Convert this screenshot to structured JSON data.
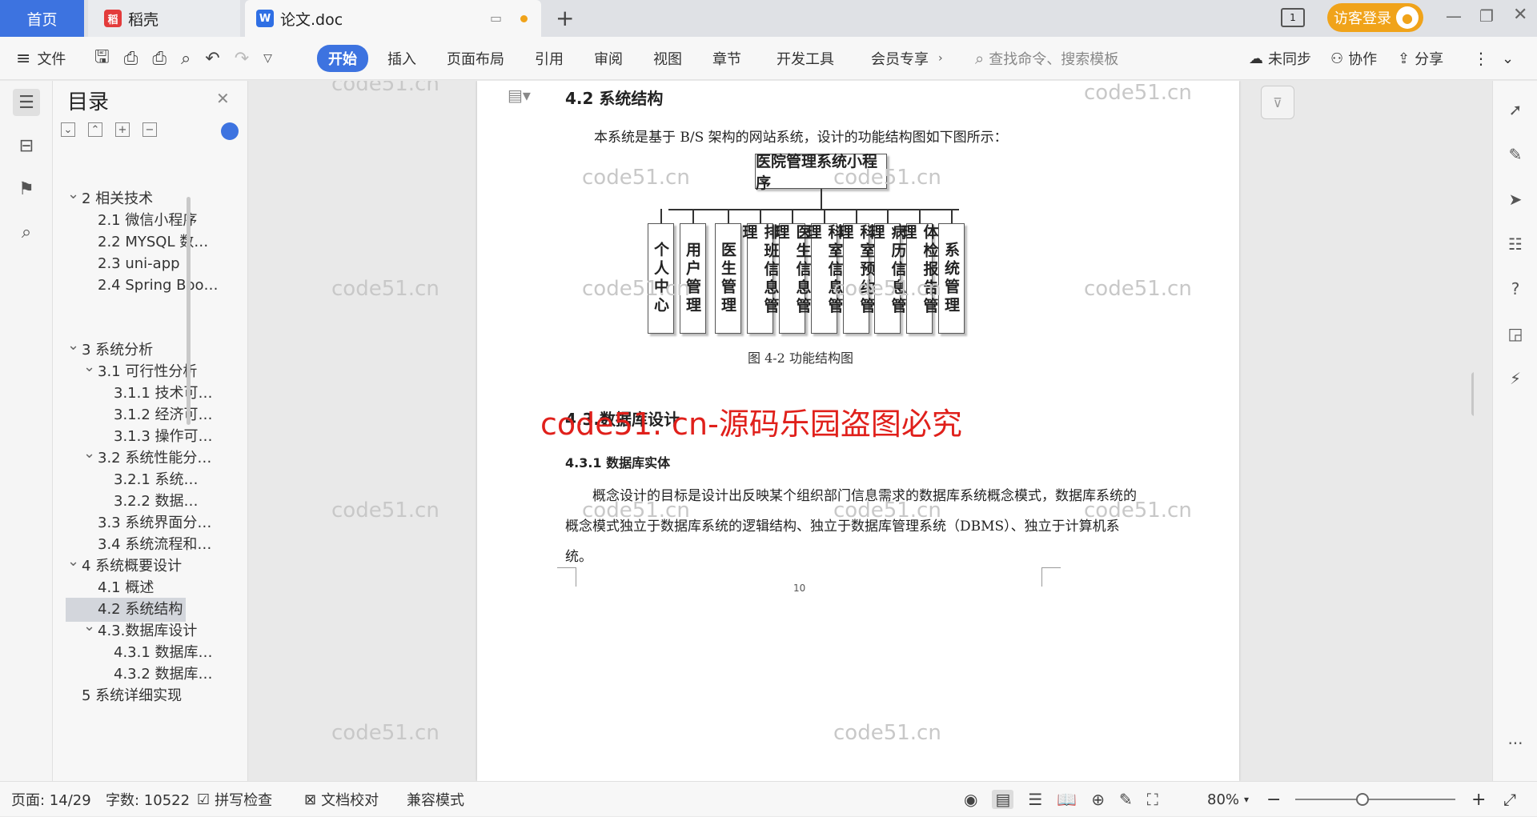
{
  "tabs": {
    "home": "首页",
    "daoke": "稻壳",
    "doc": "论文.doc"
  },
  "titlebar": {
    "login": "访客登录"
  },
  "ribbon": {
    "file": "文件",
    "items": [
      "开始",
      "插入",
      "页面布局",
      "引用",
      "审阅",
      "视图",
      "章节",
      "开发工具",
      "会员专享"
    ],
    "search_placeholder": "查找命令、搜索模板",
    "sync": "未同步",
    "collab": "协作",
    "share": "分享"
  },
  "toc": {
    "title": "目录",
    "items": [
      {
        "label": "2 相关技术",
        "level": 1,
        "arrow": "expanded"
      },
      {
        "label": "2.1 微信小程序",
        "level": 2
      },
      {
        "label": "2.2 MYSQL 数…",
        "level": 2
      },
      {
        "label": "2.3 uni-app",
        "level": 2
      },
      {
        "label": "2.4 Spring Boo…",
        "level": 2
      },
      {
        "label": "3 系统分析",
        "level": 1,
        "arrow": "expanded"
      },
      {
        "label": "3.1 可行性分析",
        "level": 2,
        "arrow": "expanded"
      },
      {
        "label": "3.1.1 技术可…",
        "level": 3
      },
      {
        "label": "3.1.2 经济可…",
        "level": 3
      },
      {
        "label": "3.1.3 操作可…",
        "level": 3
      },
      {
        "label": "3.2 系统性能分…",
        "level": 2,
        "arrow": "expanded"
      },
      {
        "label": "3.2.1  系统…",
        "level": 3
      },
      {
        "label": "3.2.2  数据…",
        "level": 3
      },
      {
        "label": "3.3 系统界面分…",
        "level": 2
      },
      {
        "label": "3.4 系统流程和…",
        "level": 2
      },
      {
        "label": "4 系统概要设计",
        "level": 1,
        "arrow": "expanded"
      },
      {
        "label": "4.1 概述",
        "level": 2
      },
      {
        "label": "4.2 系统结构",
        "level": 2,
        "active": true
      },
      {
        "label": "4.3.数据库设计",
        "level": 2,
        "arrow": "expanded"
      },
      {
        "label": "4.3.1 数据库…",
        "level": 3
      },
      {
        "label": "4.3.2 数据库…",
        "level": 3
      },
      {
        "label": "5 系统详细实现",
        "level": 1
      }
    ]
  },
  "document": {
    "heading_42": "4.2 系统结构",
    "para_42": "本系统是基于 B/S 架构的网站系统，设计的功能结构图如下图所示：",
    "diagram": {
      "root": "医院管理系统小程序",
      "children": [
        "个人中心",
        "用户管理",
        "医生管理",
        "排班信息管理",
        "医生信息管理",
        "科室信息管理",
        "科室预约管理",
        "病历信息管理",
        "体检报告管理",
        "系统管理"
      ]
    },
    "caption": "图 4-2 功能结构图",
    "heading_43": "4.3.数据库设计",
    "heading_431": "4.3.1 数据库实体",
    "para_431": "概念设计的目标是设计出反映某个组织部门信息需求的数据库系统概念模式，数据库系统的概念模式独立于数据库系统的逻辑结构、独立于数据库管理系统（DBMS）、独立于计算机系统。",
    "page_number": "10"
  },
  "watermarks": {
    "small": "code51.cn",
    "big": "code51. cn-源码乐园盗图必究"
  },
  "status": {
    "page": "页面: 14/29",
    "words": "字数: 10522",
    "spell": "拼写检查",
    "proof": "文档校对",
    "compat": "兼容模式",
    "zoom": "80%"
  },
  "colors": {
    "accent": "#3d73e0",
    "login_bg": "#f0a31a",
    "watermark_red": "#e0201b"
  }
}
